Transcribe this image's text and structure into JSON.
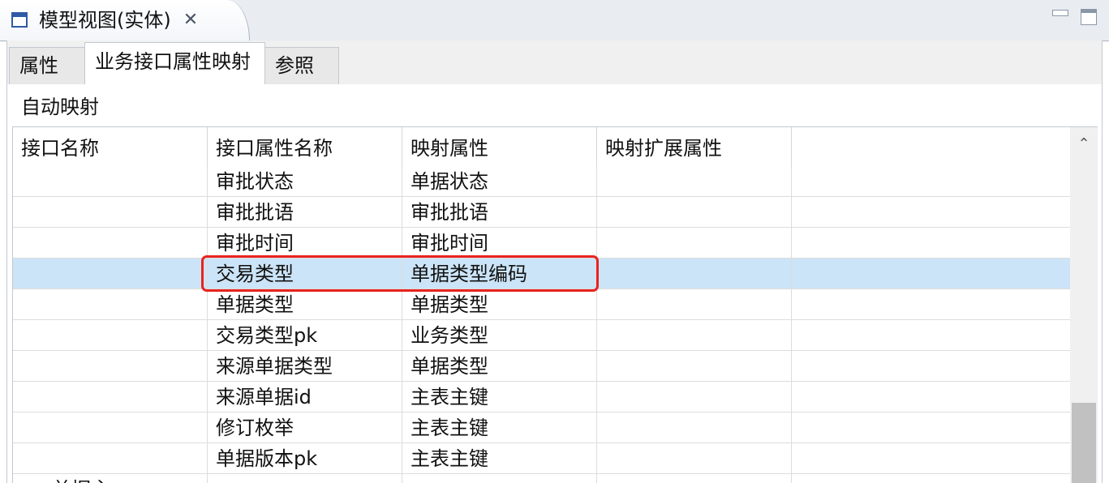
{
  "view": {
    "title": "模型视图(实体)",
    "close_glyph": "✕",
    "minimize_icon": "minimize-icon",
    "maximize_icon": "maximize-icon"
  },
  "tabs": [
    {
      "label": "属性",
      "active": false
    },
    {
      "label": "业务接口属性映射",
      "active": true
    },
    {
      "label": "参照",
      "active": false
    }
  ],
  "toolbar": {
    "auto_map_label": "自动映射"
  },
  "table": {
    "columns": [
      "接口名称",
      "接口属性名称",
      "映射属性",
      "映射扩展属性"
    ],
    "rows": [
      {
        "interface_name": "",
        "attr_name": "审批状态",
        "mapped_attr": "单据状态",
        "ext_attr": ""
      },
      {
        "interface_name": "",
        "attr_name": "审批批语",
        "mapped_attr": "审批批语",
        "ext_attr": ""
      },
      {
        "interface_name": "",
        "attr_name": "审批时间",
        "mapped_attr": "审批时间",
        "ext_attr": ""
      },
      {
        "interface_name": "",
        "attr_name": "交易类型",
        "mapped_attr": "单据类型编码",
        "ext_attr": "",
        "selected": true
      },
      {
        "interface_name": "",
        "attr_name": "单据类型",
        "mapped_attr": "单据类型",
        "ext_attr": ""
      },
      {
        "interface_name": "",
        "attr_name": "交易类型pk",
        "mapped_attr": "业务类型",
        "ext_attr": ""
      },
      {
        "interface_name": "",
        "attr_name": "来源单据类型",
        "mapped_attr": "单据类型",
        "ext_attr": ""
      },
      {
        "interface_name": "",
        "attr_name": "来源单据id",
        "mapped_attr": "主表主键",
        "ext_attr": ""
      },
      {
        "interface_name": "",
        "attr_name": "修订枚举",
        "mapped_attr": "主表主键",
        "ext_attr": ""
      },
      {
        "interface_name": "",
        "attr_name": "单据版本pk",
        "mapped_attr": "主表主键",
        "ext_attr": ""
      }
    ],
    "partial_row_text": "单据主..."
  },
  "colors": {
    "selected_row": "#cce4f7",
    "highlight_border": "#e8231f",
    "header_bg": "#e9edf2"
  }
}
